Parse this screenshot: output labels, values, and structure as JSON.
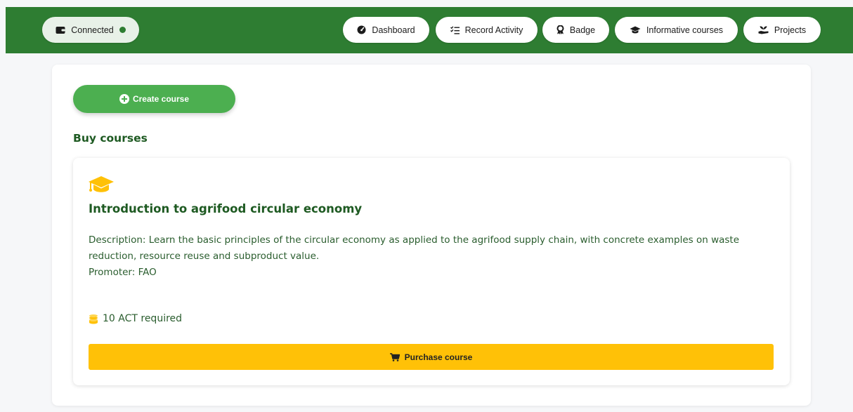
{
  "nav": {
    "connected_label": "Connected",
    "items": [
      {
        "label": "Dashboard",
        "icon": "gauge-icon"
      },
      {
        "label": "Record Activity",
        "icon": "checklist-icon"
      },
      {
        "label": "Badge",
        "icon": "award-icon"
      },
      {
        "label": "Informative courses",
        "icon": "graduation-cap-icon"
      },
      {
        "label": "Projects",
        "icon": "hand-holding-seedling-icon"
      }
    ]
  },
  "main": {
    "create_button_label": "Create course",
    "section_title": "Buy courses",
    "course": {
      "title": "Introduction to agrifood circular economy",
      "description": "Description: Learn the basic principles of the circular economy as applied to the agrifood supply chain, with concrete examples on waste reduction, resource reuse and subproduct value.",
      "promoter": "Promoter: FAO",
      "required": "10 ACT required",
      "purchase_label": "Purchase course"
    }
  },
  "colors": {
    "brand_green": "#2e7d32",
    "button_green": "#4caf50",
    "title_green": "#1e5a22",
    "accent_yellow": "#ffc107"
  }
}
